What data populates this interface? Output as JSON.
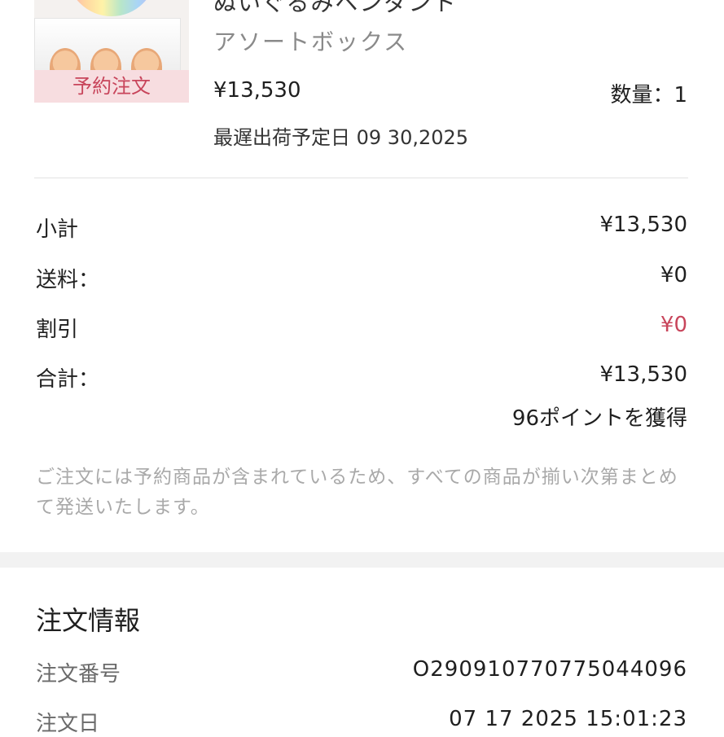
{
  "product": {
    "title": "ぬいぐるみペンダント",
    "variant": "アソートボックス",
    "tag": "予約注文",
    "price": "¥13,530",
    "quantity": "数量：1",
    "ship_date": "最遅出荷予定日 09 30,2025"
  },
  "summary": {
    "subtotal_label": "小計",
    "subtotal_value": "¥13,530",
    "shipping_label": "送料：",
    "shipping_value": "¥0",
    "discount_label": "割引",
    "discount_value": "¥0",
    "total_label": "合計：",
    "total_value": "¥13,530",
    "points": "96ポイントを獲得"
  },
  "note": "ご注文には予約商品が含まれているため、すべての商品が揃い次第まとめて発送いたします。",
  "order_info": {
    "title": "注文情報",
    "number_label": "注文番号",
    "number_value": "O290910770775044096",
    "date_label": "注文日",
    "date_value": "07 17 2025 15:01:23"
  },
  "colors": {
    "accent": "#c8455b",
    "tag_bg": "#f7dde0",
    "muted": "#a9a9a9"
  }
}
